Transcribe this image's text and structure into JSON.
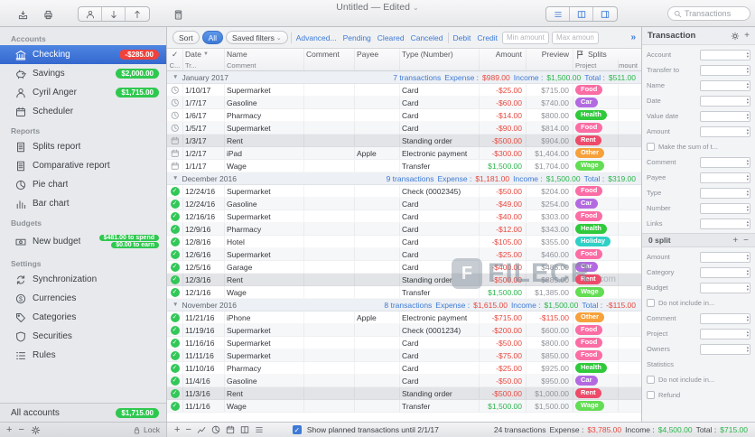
{
  "window": {
    "title": "Untitled — Edited",
    "title_chevron": "⌄"
  },
  "toolbar": {
    "search_placeholder": "Transactions"
  },
  "sidebar": {
    "sections": [
      {
        "title": "Accounts",
        "items": [
          {
            "label": "Checking",
            "icon": "bank",
            "badge": "-$285.00",
            "badge_color": "#ef423c",
            "selected": true
          },
          {
            "label": "Savings",
            "icon": "piggy",
            "badge": "$2,000.00",
            "badge_color": "#2fc84f"
          },
          {
            "label": "Cyril Anger",
            "icon": "person",
            "badge": "$1,715.00",
            "badge_color": "#2fc84f"
          },
          {
            "label": "Scheduler",
            "icon": "calendar"
          }
        ]
      },
      {
        "title": "Reports",
        "items": [
          {
            "label": "Splits report",
            "icon": "doc"
          },
          {
            "label": "Comparative report",
            "icon": "doc"
          },
          {
            "label": "Pie chart",
            "icon": "pie"
          },
          {
            "label": "Bar chart",
            "icon": "bar"
          }
        ]
      },
      {
        "title": "Budgets",
        "items": [
          {
            "label": "New budget",
            "icon": "budget",
            "badges": [
              {
                "label": "$481.00 to spend",
                "color": "#2fc84f"
              },
              {
                "label": "$0.00 to earn",
                "color": "#2fc84f"
              }
            ]
          }
        ]
      },
      {
        "title": "Settings",
        "items": [
          {
            "label": "Synchronization",
            "icon": "sync"
          },
          {
            "label": "Currencies",
            "icon": "currency"
          },
          {
            "label": "Categories",
            "icon": "tag"
          },
          {
            "label": "Securities",
            "icon": "shield"
          },
          {
            "label": "Rules",
            "icon": "rules"
          }
        ]
      }
    ],
    "footer": {
      "label": "All accounts",
      "badge": "$1,715.00",
      "badge_color": "#2fc84f"
    },
    "lock_label": "Lock"
  },
  "filterbar": {
    "sort": "Sort",
    "all": "All",
    "saved_filters": "Saved filters",
    "advanced": "Advanced...",
    "pending": "Pending",
    "cleared": "Cleared",
    "canceled": "Canceled",
    "debit": "Debit",
    "credit": "Credit",
    "min_placeholder": "Min amount",
    "max_placeholder": "Max amount",
    "expand": "»"
  },
  "table": {
    "labels": {
      "expense": "Expense :",
      "income": "Income :",
      "total": "Total :"
    },
    "header_row1": {
      "check": "✓",
      "date": "Date",
      "name": "Name",
      "comment": "Comment",
      "payee": "Payee",
      "type": "Type (Number)",
      "amount": "Amount",
      "preview": "Preview",
      "splits": "Splits"
    },
    "header_row2": {
      "c": "C...",
      "tr": "Tr...",
      "comment": "Comment",
      "project": "Project",
      "amount": "Amount"
    },
    "tag_colors": {
      "Food": "#fb6da4",
      "Car": "#b36ae0",
      "Health": "#31c93c",
      "Rent": "#ee4b6a",
      "Other": "#f6a13c",
      "Wage": "#63dd54",
      "Holiday": "#2fd0c6"
    },
    "groups": [
      {
        "month": "January 2017",
        "summary": {
          "count": "7 transactions",
          "expense": "$989.00",
          "income": "$1,500.00",
          "total": "$511.00",
          "total_negative": false
        },
        "rows": [
          {
            "status": "clock",
            "date": "1/10/17",
            "name": "Supermarket",
            "payee": "",
            "type": "Card",
            "amount": "-$25.00",
            "positive": false,
            "preview": "$715.00",
            "preview_negative": false,
            "tag": "Food",
            "highlight": false
          },
          {
            "status": "clock",
            "date": "1/7/17",
            "name": "Gasoline",
            "payee": "",
            "type": "Card",
            "amount": "-$60.00",
            "positive": false,
            "preview": "$740.00",
            "preview_negative": false,
            "tag": "Car",
            "highlight": false
          },
          {
            "status": "clock",
            "date": "1/6/17",
            "name": "Pharmacy",
            "payee": "",
            "type": "Card",
            "amount": "-$14.00",
            "positive": false,
            "preview": "$800.00",
            "preview_negative": false,
            "tag": "Health",
            "highlight": false
          },
          {
            "status": "clock",
            "date": "1/5/17",
            "name": "Supermarket",
            "payee": "",
            "type": "Card",
            "amount": "-$90.00",
            "positive": false,
            "preview": "$814.00",
            "preview_negative": false,
            "tag": "Food",
            "highlight": false
          },
          {
            "status": "calendar",
            "date": "1/3/17",
            "name": "Rent",
            "payee": "",
            "type": "Standing order",
            "amount": "-$500.00",
            "positive": false,
            "preview": "$904.00",
            "preview_negative": false,
            "tag": "Rent",
            "highlight": true
          },
          {
            "status": "calendar",
            "date": "1/2/17",
            "name": "iPad",
            "payee": "Apple",
            "type": "Electronic payment",
            "amount": "-$300.00",
            "positive": false,
            "preview": "$1,404.00",
            "preview_negative": false,
            "tag": "Other",
            "highlight": false
          },
          {
            "status": "calendar",
            "date": "1/1/17",
            "name": "Wage",
            "payee": "",
            "type": "Transfer",
            "amount": "$1,500.00",
            "positive": true,
            "preview": "$1,704.00",
            "preview_negative": false,
            "tag": "Wage",
            "highlight": false
          }
        ]
      },
      {
        "month": "December 2016",
        "summary": {
          "count": "9 transactions",
          "expense": "$1,181.00",
          "income": "$1,500.00",
          "total": "$319.00",
          "total_negative": false
        },
        "rows": [
          {
            "status": "check",
            "date": "12/24/16",
            "name": "Supermarket",
            "payee": "",
            "type": "Check (0002345)",
            "amount": "-$50.00",
            "positive": false,
            "preview": "$204.00",
            "preview_negative": false,
            "tag": "Food",
            "highlight": false
          },
          {
            "status": "check",
            "date": "12/24/16",
            "name": "Gasoline",
            "payee": "",
            "type": "Card",
            "amount": "-$49.00",
            "positive": false,
            "preview": "$254.00",
            "preview_negative": false,
            "tag": "Car",
            "highlight": false
          },
          {
            "status": "check",
            "date": "12/16/16",
            "name": "Supermarket",
            "payee": "",
            "type": "Card",
            "amount": "-$40.00",
            "positive": false,
            "preview": "$303.00",
            "preview_negative": false,
            "tag": "Food",
            "highlight": false
          },
          {
            "status": "check",
            "date": "12/9/16",
            "name": "Pharmacy",
            "payee": "",
            "type": "Card",
            "amount": "-$12.00",
            "positive": false,
            "preview": "$343.00",
            "preview_negative": false,
            "tag": "Health",
            "highlight": false
          },
          {
            "status": "check",
            "date": "12/8/16",
            "name": "Hotel",
            "payee": "",
            "type": "Card",
            "amount": "-$105.00",
            "positive": false,
            "preview": "$355.00",
            "preview_negative": false,
            "tag": "Holiday",
            "highlight": false
          },
          {
            "status": "check",
            "date": "12/6/16",
            "name": "Supermarket",
            "payee": "",
            "type": "Card",
            "amount": "-$25.00",
            "positive": false,
            "preview": "$460.00",
            "preview_negative": false,
            "tag": "Food",
            "highlight": false
          },
          {
            "status": "check",
            "date": "12/5/16",
            "name": "Garage",
            "payee": "",
            "type": "Card",
            "amount": "-$400.00",
            "positive": false,
            "preview": "$485.00",
            "preview_negative": false,
            "tag": "Car",
            "highlight": false
          },
          {
            "status": "check",
            "date": "12/3/16",
            "name": "Rent",
            "payee": "",
            "type": "Standing order",
            "amount": "-$500.00",
            "positive": false,
            "preview": "$885.00",
            "preview_negative": false,
            "tag": "Rent",
            "highlight": true
          },
          {
            "status": "check",
            "date": "12/1/16",
            "name": "Wage",
            "payee": "",
            "type": "Transfer",
            "amount": "$1,500.00",
            "positive": true,
            "preview": "$1,385.00",
            "preview_negative": false,
            "tag": "Wage",
            "highlight": false
          }
        ]
      },
      {
        "month": "November 2016",
        "summary": {
          "count": "8 transactions",
          "expense": "$1,615.00",
          "income": "$1,500.00",
          "total": "-$115.00",
          "total_negative": true
        },
        "rows": [
          {
            "status": "check",
            "date": "11/21/16",
            "name": "iPhone",
            "payee": "Apple",
            "type": "Electronic payment",
            "amount": "-$715.00",
            "positive": false,
            "preview": "-$115.00",
            "preview_negative": true,
            "tag": "Other",
            "highlight": false
          },
          {
            "status": "check",
            "date": "11/19/16",
            "name": "Supermarket",
            "payee": "",
            "type": "Check (0001234)",
            "amount": "-$200.00",
            "positive": false,
            "preview": "$600.00",
            "preview_negative": false,
            "tag": "Food",
            "highlight": false
          },
          {
            "status": "check",
            "date": "11/16/16",
            "name": "Supermarket",
            "payee": "",
            "type": "Card",
            "amount": "-$50.00",
            "positive": false,
            "preview": "$800.00",
            "preview_negative": false,
            "tag": "Food",
            "highlight": false
          },
          {
            "status": "check",
            "date": "11/11/16",
            "name": "Supermarket",
            "payee": "",
            "type": "Card",
            "amount": "-$75.00",
            "positive": false,
            "preview": "$850.00",
            "preview_negative": false,
            "tag": "Food",
            "highlight": false
          },
          {
            "status": "check",
            "date": "11/10/16",
            "name": "Pharmacy",
            "payee": "",
            "type": "Card",
            "amount": "-$25.00",
            "positive": false,
            "preview": "$925.00",
            "preview_negative": false,
            "tag": "Health",
            "highlight": false
          },
          {
            "status": "check",
            "date": "11/4/16",
            "name": "Gasoline",
            "payee": "",
            "type": "Card",
            "amount": "-$50.00",
            "positive": false,
            "preview": "$950.00",
            "preview_negative": false,
            "tag": "Car",
            "highlight": false
          },
          {
            "status": "check",
            "date": "11/3/16",
            "name": "Rent",
            "payee": "",
            "type": "Standing order",
            "amount": "-$500.00",
            "positive": false,
            "preview": "$1,000.00",
            "preview_negative": false,
            "tag": "Rent",
            "highlight": true
          },
          {
            "status": "check",
            "date": "11/1/16",
            "name": "Wage",
            "payee": "",
            "type": "Transfer",
            "amount": "$1,500.00",
            "positive": true,
            "preview": "$1,500.00",
            "preview_negative": false,
            "tag": "Wage",
            "highlight": false
          }
        ]
      }
    ]
  },
  "inspector": {
    "title": "Transaction",
    "sections": [
      {
        "rows": [
          {
            "label": "Account",
            "control": "stepper"
          },
          {
            "label": "Transfer to",
            "control": "stepper"
          },
          {
            "label": "Name",
            "control": "combo"
          },
          {
            "label": "Date",
            "control": "date"
          },
          {
            "label": "Value date",
            "control": "date"
          },
          {
            "label": "Amount",
            "control": "stepper"
          },
          {
            "label": "Make the sum of t...",
            "control": "checkbox"
          },
          {
            "label": "Comment",
            "control": "combo"
          },
          {
            "label": "Payee",
            "control": "combo"
          },
          {
            "label": "Type",
            "control": "combo"
          },
          {
            "label": "Number",
            "control": "stepper"
          },
          {
            "label": "Links",
            "control": "combo"
          }
        ]
      },
      {
        "header": "0 split",
        "rows": [
          {
            "label": "Amount",
            "control": "stepper"
          },
          {
            "label": "Category",
            "control": "combo"
          },
          {
            "label": "Budget",
            "control": "combo"
          },
          {
            "label": "Do not include in...",
            "control": "checkbox"
          },
          {
            "label": "Comment",
            "control": "combo"
          },
          {
            "label": "Project",
            "control": "combo"
          },
          {
            "label": "Owners",
            "control": "combo"
          },
          {
            "label": "Statistics",
            "control": "label"
          },
          {
            "label": "Do not include in...",
            "control": "checkbox"
          },
          {
            "label": "Refund",
            "control": "checkbox"
          }
        ]
      }
    ]
  },
  "statusbar": {
    "planned_label": "Show planned transactions until 2/1/17",
    "count": "24 transactions",
    "expense": "$3,785.00",
    "income": "$4,500.00",
    "total": "$715.00",
    "total_negative": false
  },
  "watermark": {
    "text": "FILECR",
    "suffix": ".com"
  }
}
